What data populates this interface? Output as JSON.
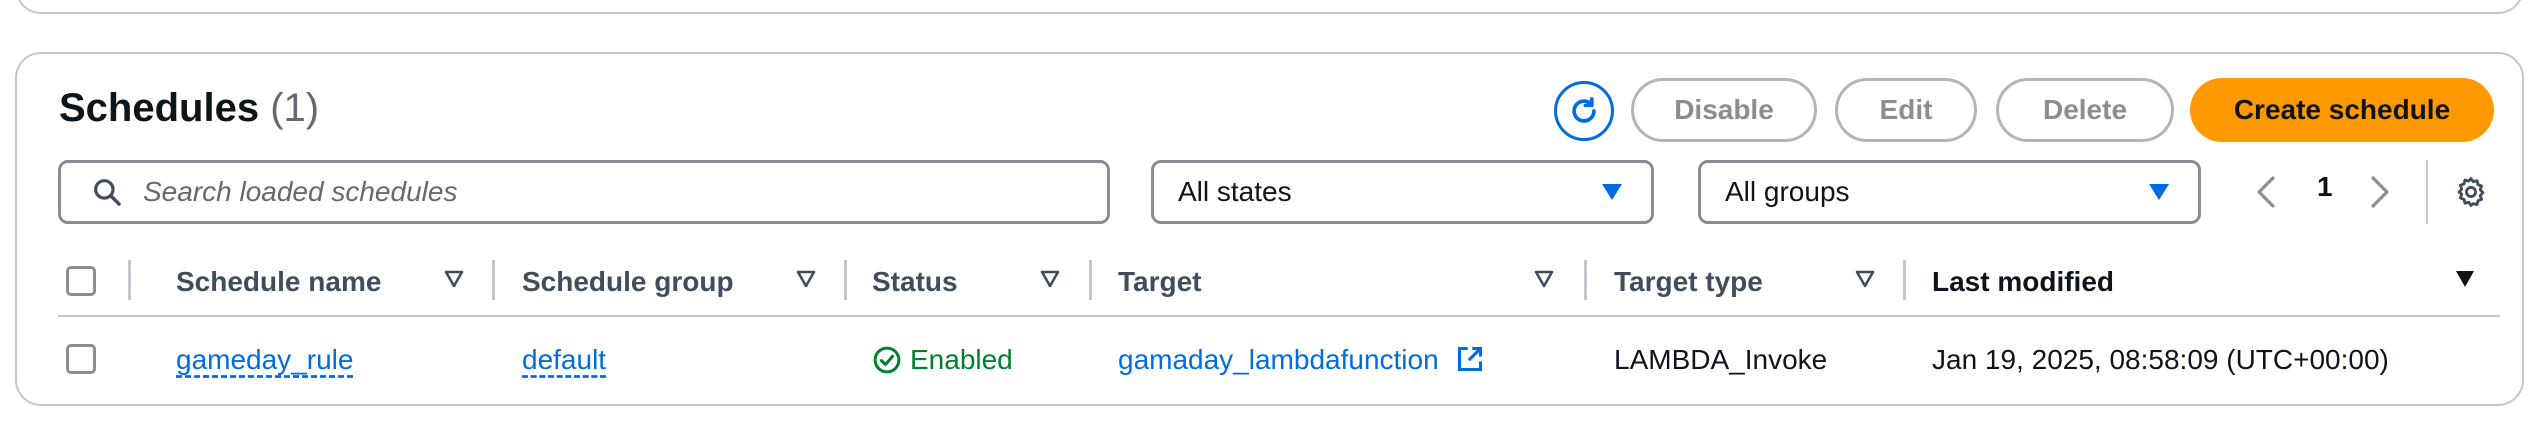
{
  "header": {
    "title": "Schedules",
    "count": "(1)"
  },
  "actions": {
    "refresh_icon": "refresh-icon",
    "disable_label": "Disable",
    "edit_label": "Edit",
    "delete_label": "Delete",
    "create_label": "Create schedule",
    "primary_color": "#ff9900",
    "link_color": "#006ce0"
  },
  "filters": {
    "search_placeholder": "Search loaded schedules",
    "search_value": "",
    "states_selected": "All states",
    "groups_selected": "All groups"
  },
  "pagination": {
    "current_page": "1"
  },
  "table": {
    "columns": [
      {
        "label": "Schedule name"
      },
      {
        "label": "Schedule group"
      },
      {
        "label": "Status"
      },
      {
        "label": "Target"
      },
      {
        "label": "Target type"
      },
      {
        "label": "Last modified"
      }
    ],
    "rows": [
      {
        "schedule_name": "gameday_rule",
        "schedule_group": "default",
        "status": "Enabled",
        "status_color": "#00802f",
        "target": "gamaday_lambdafunction",
        "target_type": "LAMBDA_Invoke",
        "last_modified": "Jan 19, 2025, 08:58:09 (UTC+00:00)"
      }
    ]
  }
}
